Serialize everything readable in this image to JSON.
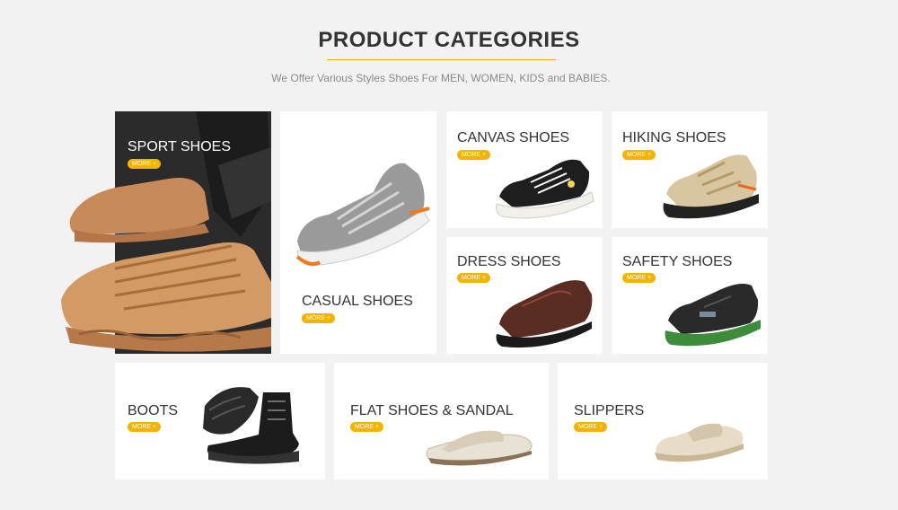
{
  "header": {
    "title": "PRODUCT CATEGORIES",
    "subtitle": "We Offer Various Styles Shoes For MEN, WOMEN, KIDS and BABIES."
  },
  "more_label": "MORE +",
  "categories": [
    {
      "label": "SPORT SHOES"
    },
    {
      "label": "CASUAL SHOES"
    },
    {
      "label": "CANVAS SHOES"
    },
    {
      "label": "HIKING SHOES"
    },
    {
      "label": "DRESS SHOES"
    },
    {
      "label": "SAFETY SHOES"
    },
    {
      "label": "BOOTS"
    },
    {
      "label": "FLAT SHOES & SANDAL"
    },
    {
      "label": "SLIPPERS"
    }
  ],
  "colors": {
    "accent": "#f3b300",
    "background": "#f2f2f2",
    "card": "#ffffff",
    "title": "#333333"
  }
}
